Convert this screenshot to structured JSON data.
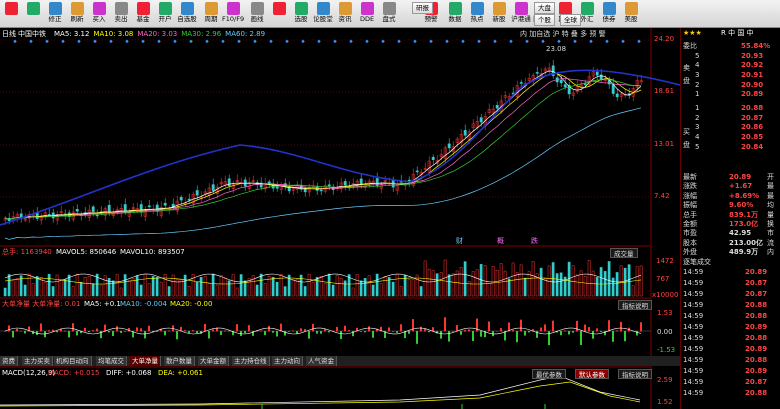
{
  "toolbar": {
    "items": [
      "",
      "",
      "修正",
      "刷新",
      "买入",
      "卖出",
      "基金",
      "开户",
      "自选股",
      "周期",
      "F10/F9",
      "画线",
      "",
      "选股",
      "论股堂",
      "资讯",
      "DDE",
      "盘式",
      "预警",
      "数据",
      "热点",
      "新股",
      "沪港通",
      "陆港通",
      "期权",
      "外汇",
      "债券",
      "美股",
      "自定义",
      "多窗口"
    ],
    "sub": {
      "vr": "研报",
      "dp": "大盘",
      "zx": "个股",
      "gl": "全球"
    }
  },
  "stock": {
    "label": "日线",
    "name": "中国中铁",
    "mas": [
      {
        "t": "MA5: 3.12",
        "c": "#ffffff"
      },
      {
        "t": "MA10: 3.08",
        "c": "#ffff00"
      },
      {
        "t": "MA20: 3.03",
        "c": "#ff66cc"
      },
      {
        "t": "MA30: 2.96",
        "c": "#33cc33"
      },
      {
        "t": "MA60: 2.89",
        "c": "#66ccff"
      }
    ],
    "toptags": "内 加自选 沪 特 叠 多 预 警",
    "prices": [
      "24.20",
      "18.61",
      "13.01",
      "7.42"
    ],
    "high": "23.08",
    "events": [
      "财",
      "概",
      "跌"
    ]
  },
  "vol": {
    "t1": "总手: 1163940",
    "t2": "MAVOL5: 850646",
    "t3": "MAVOL10: 893507",
    "btn": "成交量",
    "scale": [
      "1472",
      "767",
      "x10000"
    ]
  },
  "flow": {
    "t1": "大单净量 大单净量: 0.01",
    "t2": "MA5: +0.1",
    "t3": "MA10: -0.004",
    "t4": "MA20: -0.00",
    "btn": "指标说明",
    "scale": [
      "1.53",
      "0.00",
      "-1.53"
    ]
  },
  "tabs": [
    "资费",
    "主力买卖",
    "机构目动向",
    "均笔成交",
    "大单净量",
    "散户数量",
    "大单金额",
    "主力持仓线",
    "主力动向",
    "人气资金"
  ],
  "macd": {
    "t1": "MACD(12,26,9)",
    "t2": "MACD: +0.015",
    "t3": "DIFF: +0.068",
    "t4": "DEA: +0.061",
    "b1": "最优参数",
    "b2": "默认参数",
    "b3": "指标说明",
    "scale": [
      "2.59",
      "1.52"
    ]
  },
  "panel": {
    "icons": "R 中 国 中",
    "ratio_label": "委比",
    "ratio": "55.84%",
    "asks": [
      {
        "n": "5",
        "p": "20.93"
      },
      {
        "n": "4",
        "p": "20.92"
      },
      {
        "n": "3",
        "p": "20.91"
      },
      {
        "n": "2",
        "p": "20.90"
      },
      {
        "n": "1",
        "p": "20.89"
      }
    ],
    "bids": [
      {
        "n": "1",
        "p": "20.88"
      },
      {
        "n": "2",
        "p": "20.87"
      },
      {
        "n": "3",
        "p": "20.86"
      },
      {
        "n": "4",
        "p": "20.85"
      },
      {
        "n": "5",
        "p": "20.84"
      }
    ],
    "sell_label": "卖盘",
    "buy_label": "买盘",
    "stats": [
      {
        "k": "最新",
        "v": "20.89",
        "s": "开"
      },
      {
        "k": "涨跌",
        "v": "+1.67",
        "s": "最"
      },
      {
        "k": "涨幅",
        "v": "+8.69%",
        "s": "最"
      },
      {
        "k": "振幅",
        "v": "9.60%",
        "s": "均"
      },
      {
        "k": "总手",
        "v": "839.1万",
        "s": "量"
      },
      {
        "k": "金额",
        "v": "173.0亿",
        "s": "换"
      },
      {
        "k": "市盈",
        "v": "42.95",
        "s": "市"
      },
      {
        "k": "股本",
        "v": "213.00亿",
        "s": "流"
      },
      {
        "k": "外盘",
        "v": "489.9万",
        "s": "内"
      }
    ],
    "trades_title": "逐笔成交",
    "trades": [
      {
        "t": "14:59",
        "p": "20.89"
      },
      {
        "t": "14:59",
        "p": "20.87"
      },
      {
        "t": "14:59",
        "p": "20.87"
      },
      {
        "t": "14:59",
        "p": "20.88"
      },
      {
        "t": "14:59",
        "p": "20.88"
      },
      {
        "t": "14:59",
        "p": "20.89"
      },
      {
        "t": "14:59",
        "p": "20.88"
      },
      {
        "t": "14:59",
        "p": "20.89"
      },
      {
        "t": "14:59",
        "p": "20.88"
      },
      {
        "t": "14:59",
        "p": "20.89"
      },
      {
        "t": "14:59",
        "p": "20.87"
      },
      {
        "t": "14:59",
        "p": "20.88"
      }
    ]
  }
}
